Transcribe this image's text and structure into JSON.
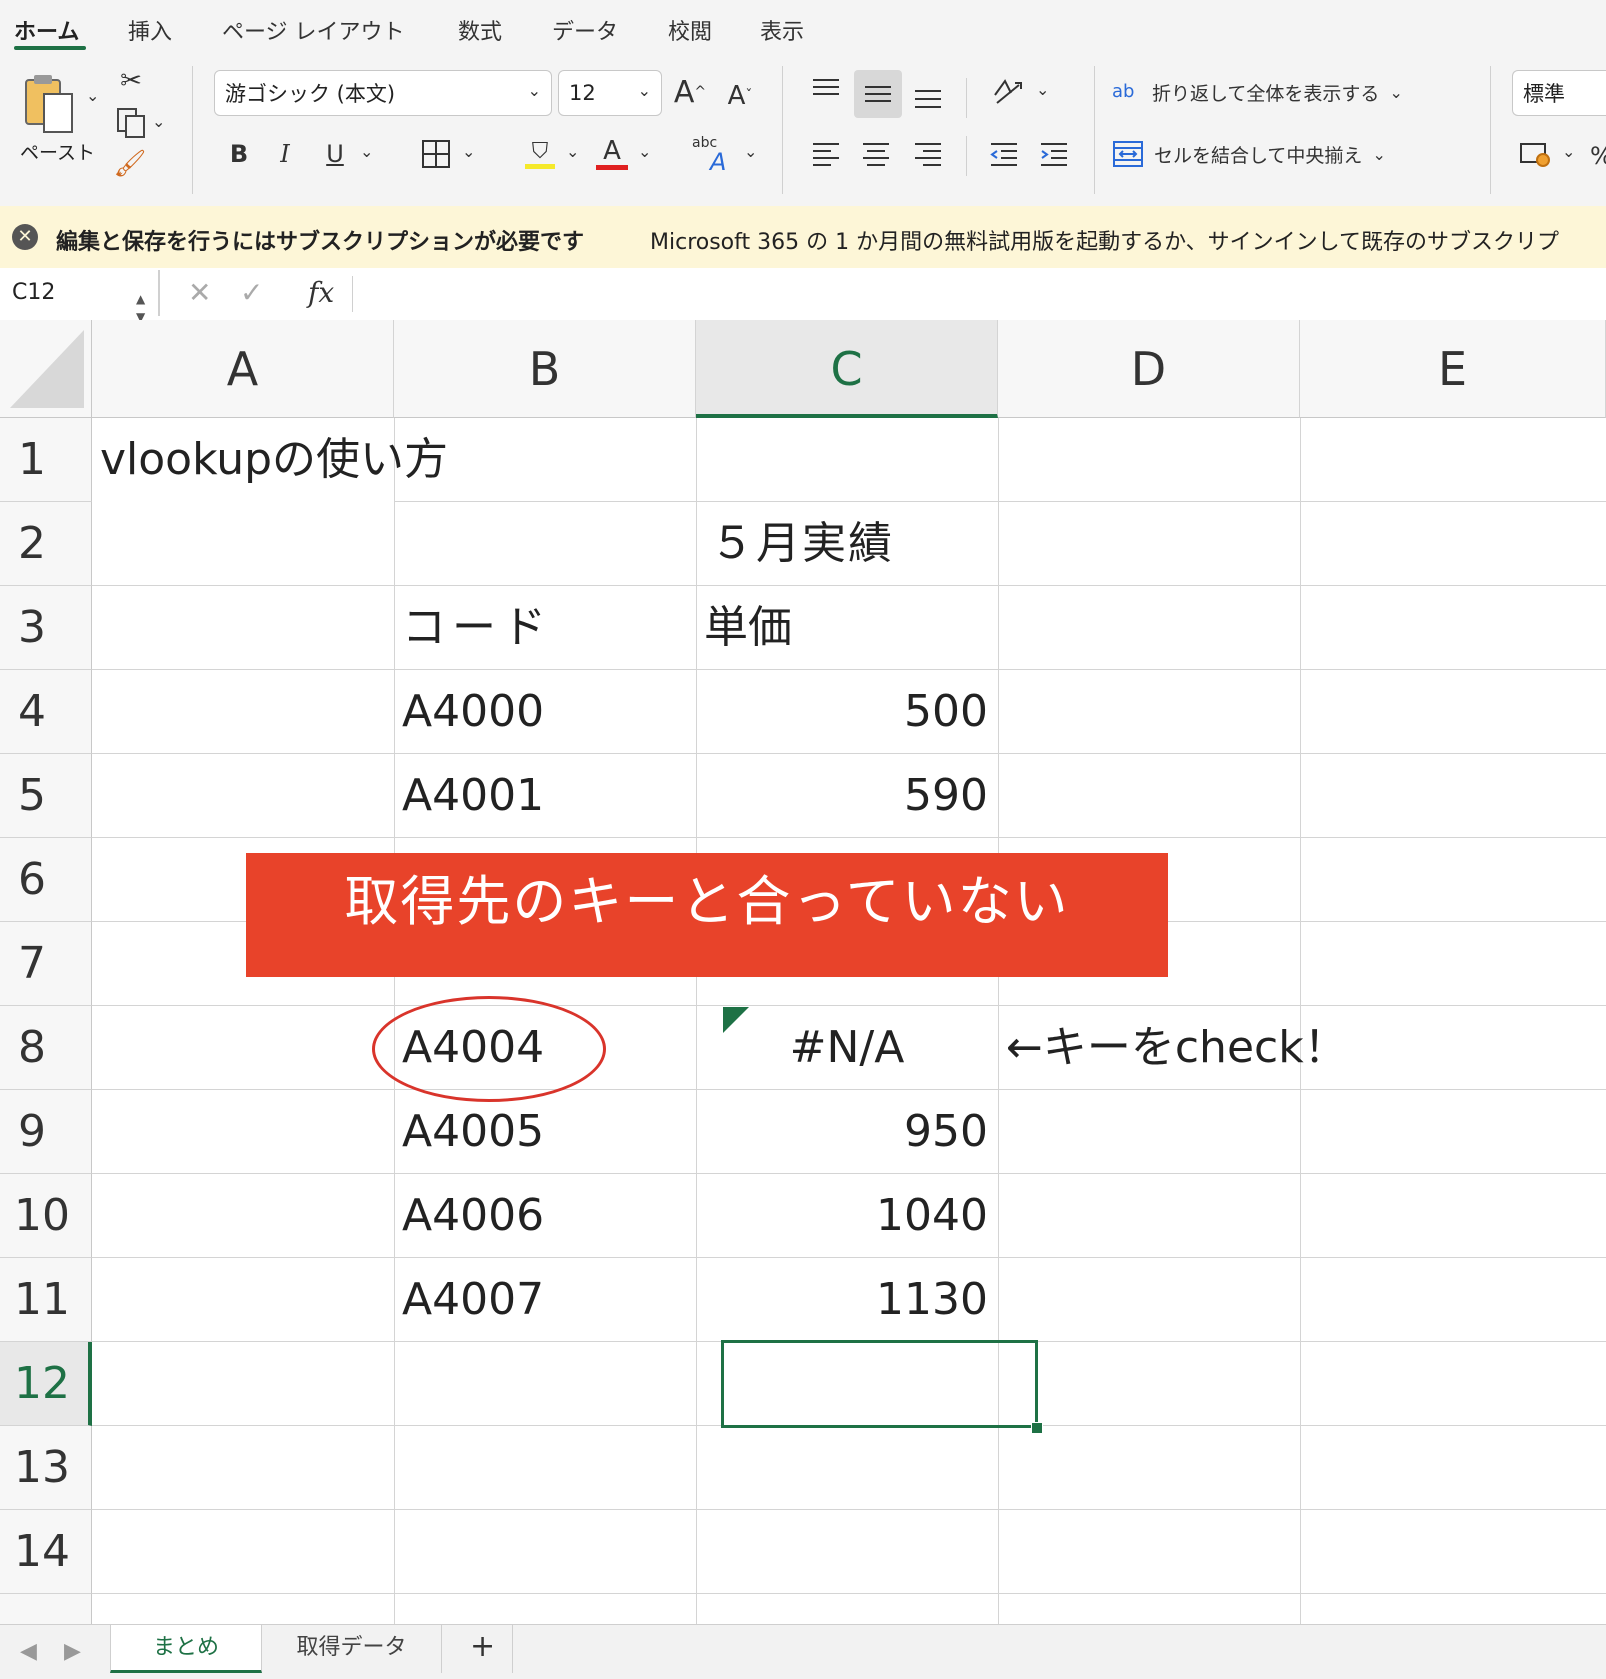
{
  "ribbon_tabs": [
    "ホーム",
    "挿入",
    "ページ レイアウト",
    "数式",
    "データ",
    "校閲",
    "表示"
  ],
  "ribbon": {
    "paste_label": "ペースト",
    "font_name": "游ゴシック (本文)",
    "font_size": "12",
    "bold": "B",
    "italic": "I",
    "underline": "U",
    "grow_font": "A",
    "shrink_font": "A",
    "font_color_letter": "A",
    "phonetic_label": "abc",
    "wrap_text_label": "折り返して全体を表示する",
    "merge_center_label": "セルを結合して中央揃え",
    "number_format": "標準",
    "wrap_icon_text": "ab",
    "font_color": "#e02020",
    "highlight_color": "#f5e92a"
  },
  "message_bar": {
    "title": "編集と保存を行うにはサブスクリプションが必要です",
    "text": "Microsoft 365 の 1 か月間の無料試用版を起動するか、サインインして既存のサブスクリプ"
  },
  "formula_bar": {
    "name_box": "C12",
    "fx": "fx",
    "cancel": "✕",
    "enter": "✓"
  },
  "columns": [
    "A",
    "B",
    "C",
    "D",
    "E"
  ],
  "selected_column": "C",
  "rows": [
    "1",
    "2",
    "3",
    "4",
    "5",
    "6",
    "7",
    "8",
    "9",
    "10",
    "11",
    "12",
    "13",
    "14"
  ],
  "selected_row": "12",
  "cells": {
    "A1": "vlookupの使い方",
    "C2": "５月実績",
    "B3": "コード",
    "C3": "単価",
    "B4": "A4000",
    "C4": "500",
    "B5": "A4001",
    "C5": "590",
    "B8": "A4004",
    "C8": "#N/A",
    "D8": "←キーをcheck！",
    "B9": "A4005",
    "C9": "950",
    "B10": "A4006",
    "C10": "1040",
    "B11": "A4007",
    "C11": "1130"
  },
  "annotation": {
    "banner_text": "取得先のキーと合っていない",
    "banner_color": "#e8432a",
    "circle_color": "#d9342b"
  },
  "sheet_tabs": [
    "まとめ",
    "取得データ"
  ],
  "active_sheet": "まとめ",
  "accent_color": "#1e7145"
}
